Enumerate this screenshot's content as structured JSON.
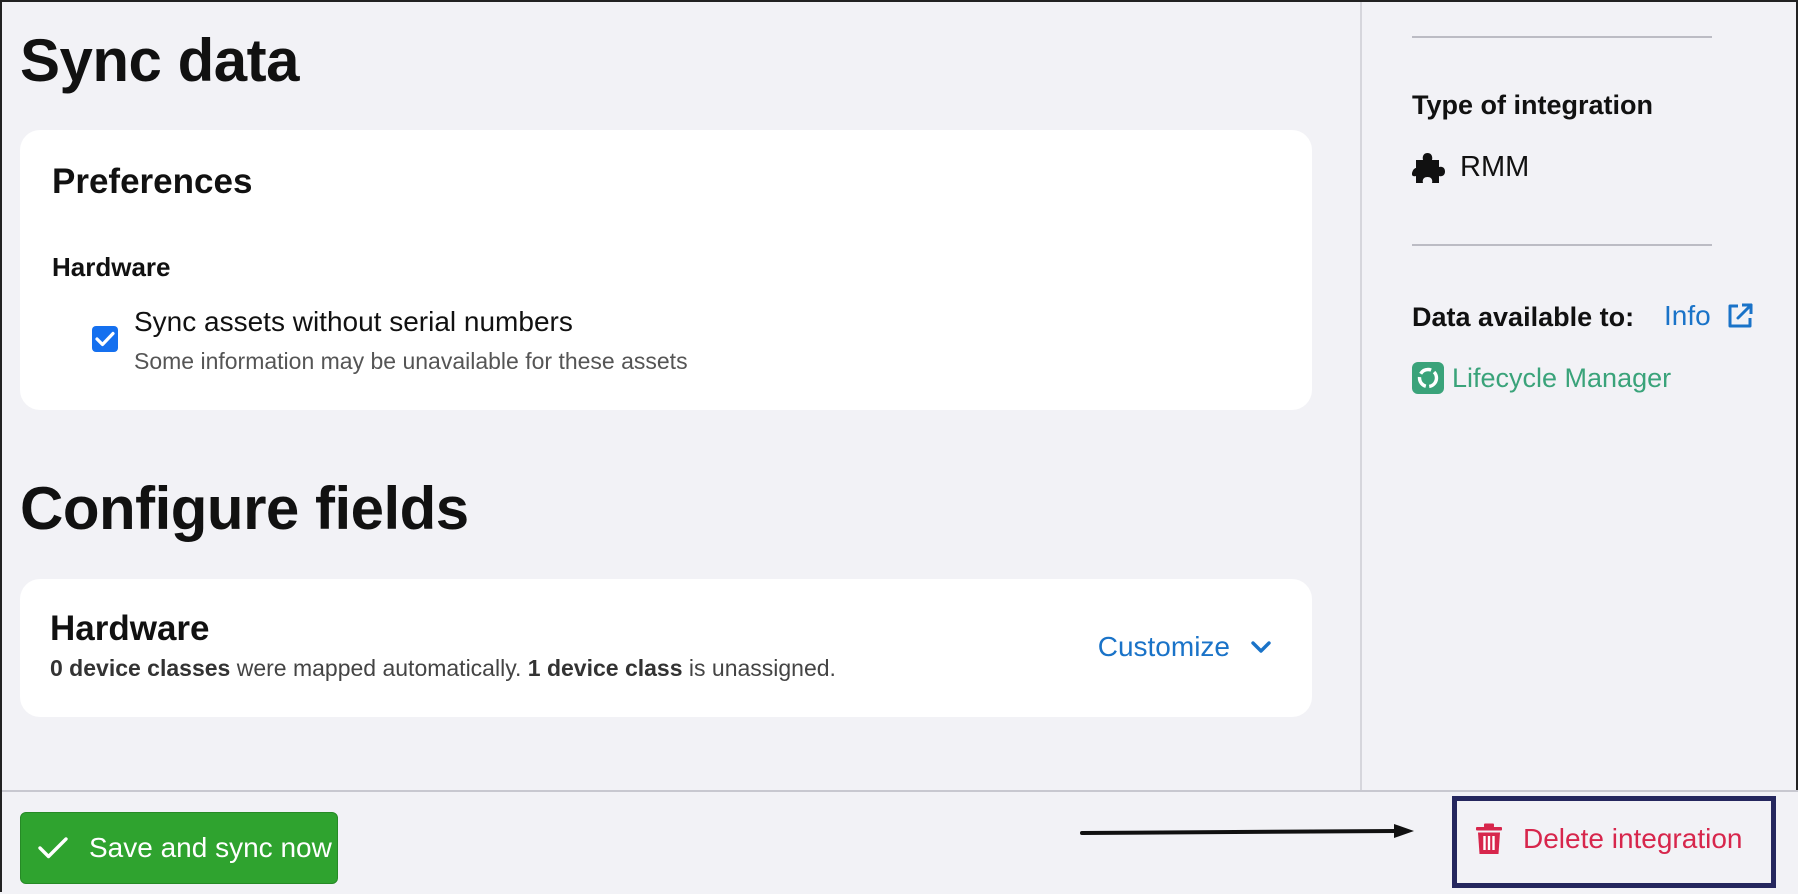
{
  "main": {
    "sync_title": "Sync data",
    "preferences": {
      "title": "Preferences",
      "section": "Hardware",
      "checkbox_label": "Sync assets without serial numbers",
      "checkbox_help": "Some information may be unavailable for these assets",
      "checked": true
    },
    "configure_title": "Configure fields",
    "hardware_card": {
      "title": "Hardware",
      "mapped_count": "0 device classes",
      "mapped_text": " were mapped automatically. ",
      "unassigned_count": "1 device class",
      "unassigned_text": " is unassigned.",
      "customize_label": "Customize"
    }
  },
  "sidebar": {
    "type_label": "Type of integration",
    "type_value": "RMM",
    "data_available_label": "Data available to:",
    "info_link": "Info",
    "product_name": "Lifecycle Manager"
  },
  "footer": {
    "save_label": "Save and sync now",
    "delete_label": "Delete integration"
  },
  "colors": {
    "accent_blue": "#1a73c8",
    "save_green": "#2fa32f",
    "delete_red": "#d7264c",
    "highlight_box": "#25275e",
    "product_green": "#3aa37a"
  }
}
